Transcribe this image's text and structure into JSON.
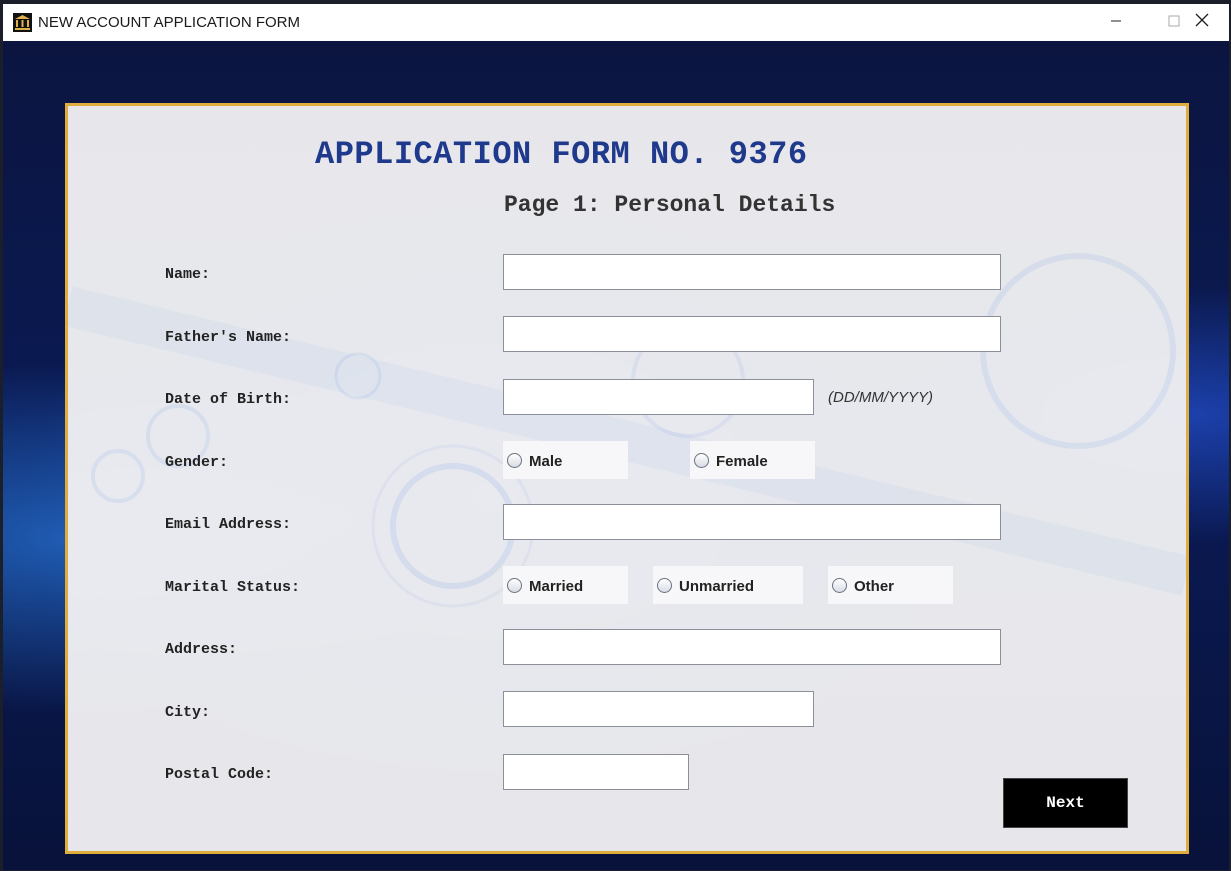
{
  "window": {
    "title": "NEW ACCOUNT APPLICATION FORM",
    "minimize_icon": "minimize-icon",
    "maximize_icon": "maximize-icon",
    "close_icon": "close-icon"
  },
  "form": {
    "title": "APPLICATION FORM NO. 9376",
    "subtitle": "Page 1: Personal Details",
    "fields": {
      "name": {
        "label": "Name:",
        "value": ""
      },
      "father_name": {
        "label": "Father's Name:",
        "value": ""
      },
      "dob": {
        "label": "Date of Birth:",
        "value": "",
        "hint": "(DD/MM/YYYY)"
      },
      "gender": {
        "label": "Gender:",
        "options": [
          "Male",
          "Female"
        ],
        "selected": null
      },
      "email": {
        "label": "Email Address:",
        "value": ""
      },
      "marital_status": {
        "label": "Marital Status:",
        "options": [
          "Married",
          "Unmarried",
          "Other"
        ],
        "selected": null
      },
      "address": {
        "label": "Address:",
        "value": ""
      },
      "city": {
        "label": "City:",
        "value": ""
      },
      "postal_code": {
        "label": "Postal Code:",
        "value": ""
      }
    },
    "next_label": "Next"
  },
  "colors": {
    "title": "#1f3a8c",
    "panel_border": "#e0ad3c",
    "next_button_bg": "#000000",
    "background": "#0a1433"
  }
}
